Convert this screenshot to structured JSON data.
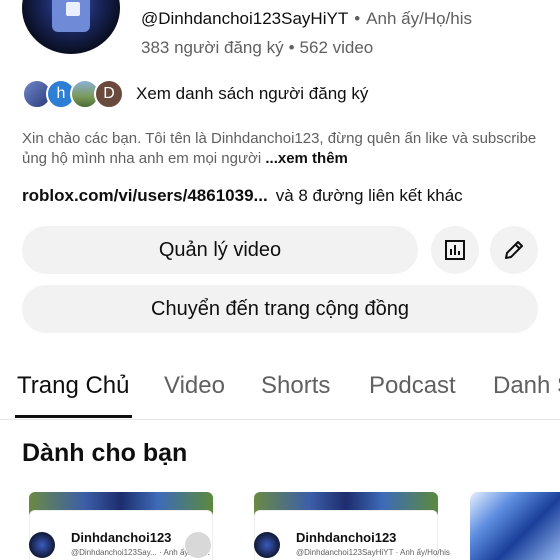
{
  "channel": {
    "handle": "@Dinhdanchoi123SayHiYT",
    "separator": "•",
    "pronouns": "Anh ấy/Họ/his",
    "subscribers": "383 người đăng ký",
    "videos": "562 video",
    "subscriber_avatar_letters": [
      "h",
      "D"
    ],
    "subscribers_link": "Xem danh sách người đăng ký",
    "description": "Xin chào các bạn. Tôi tên là Dinhdanchoi123, đừng quên ấn like và subscribe ủng hộ mình nha anh em mọi người",
    "more": "...xem thêm",
    "link": "roblox.com/vi/users/4861039...",
    "links_extra": "và 8 đường liên kết khác"
  },
  "actions": {
    "manage_videos": "Quản lý video",
    "analytics_icon": "analytics-icon",
    "edit_icon": "pencil-icon",
    "community": "Chuyển đến trang cộng đồng"
  },
  "tabs": [
    {
      "label": "Trang Chủ",
      "active": true
    },
    {
      "label": "Video"
    },
    {
      "label": "Shorts"
    },
    {
      "label": "Podcast"
    },
    {
      "label": "Danh S"
    }
  ],
  "section": {
    "title": "Dành cho bạn"
  },
  "cards": [
    {
      "name": "Dinhdanchoi123",
      "handle": "@Dinhdanchoi123Say...",
      "pronouns": "Anh ấy/Họ/..."
    },
    {
      "name": "Dinhdanchoi123",
      "handle": "@Dinhdanchoi123SayHiYT",
      "pronouns": "Anh ấy/Họ/his"
    }
  ],
  "colors": {
    "text_primary": "#0f0f0f",
    "text_secondary": "#606060",
    "chip_bg": "#f2f2f2"
  }
}
